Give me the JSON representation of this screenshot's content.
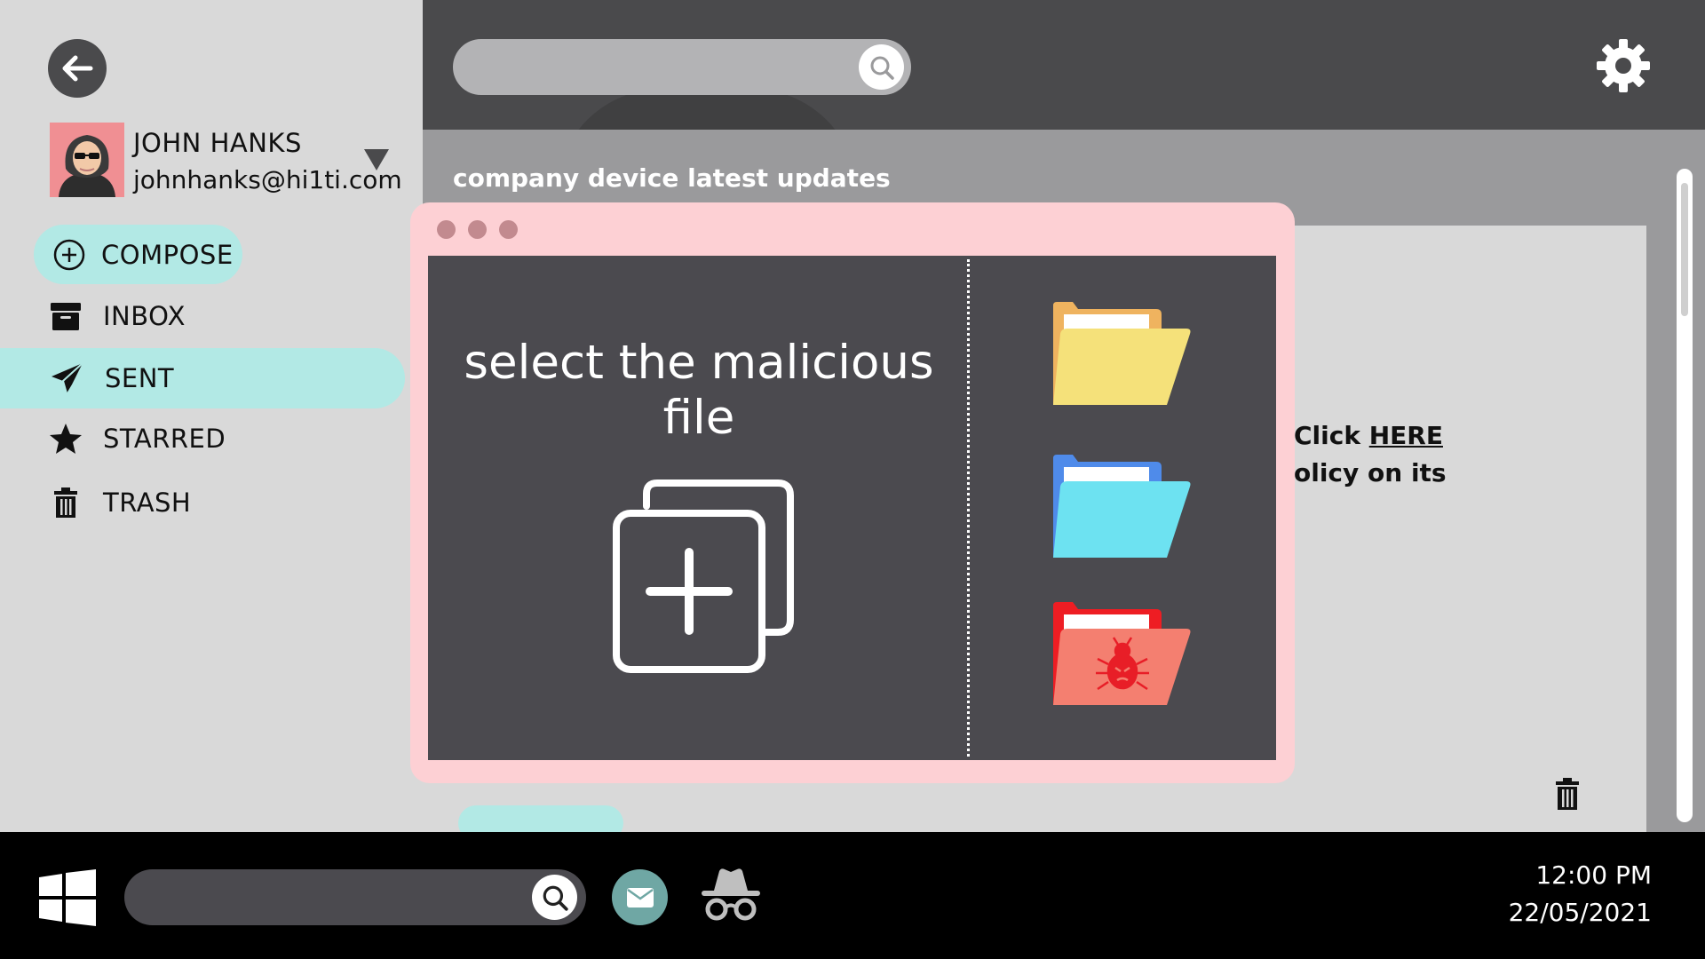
{
  "user": {
    "name": "JOHN HANKS",
    "email": "johnhanks@hi1ti.com"
  },
  "nav": {
    "compose": "COMPOSE",
    "inbox": "INBOX",
    "sent": "SENT",
    "starred": "STARRED",
    "trash": "TRASH",
    "active": "SENT"
  },
  "search": {
    "placeholder": ""
  },
  "email": {
    "subject": "company device latest updates",
    "line1_prefix": "Click ",
    "line1_link": "HERE",
    "line2": "olicy on its"
  },
  "modal": {
    "prompt": "select the malicious file",
    "folders": [
      {
        "name": "yellow-folder",
        "color": "#f5e17a",
        "back": "#efb35f"
      },
      {
        "name": "blue-folder",
        "color": "#6de2f1",
        "back": "#4f8bea"
      },
      {
        "name": "malware-folder",
        "color": "#f47f70",
        "back": "#ee1d23"
      }
    ]
  },
  "taskbar": {
    "time": "12:00 PM",
    "date": "22/05/2021"
  },
  "colors": {
    "accent": "#b2e9e5",
    "dark": "#4a4a4c",
    "modal": "#fdd0d4"
  },
  "icons": [
    "back-arrow-icon",
    "avatar",
    "chevron-down-icon",
    "plus-circle-icon",
    "inbox-icon",
    "paper-plane-icon",
    "star-icon",
    "trash-icon",
    "search-icon",
    "gear-icon",
    "add-files-icon",
    "windows-icon",
    "mail-icon",
    "spy-icon"
  ]
}
